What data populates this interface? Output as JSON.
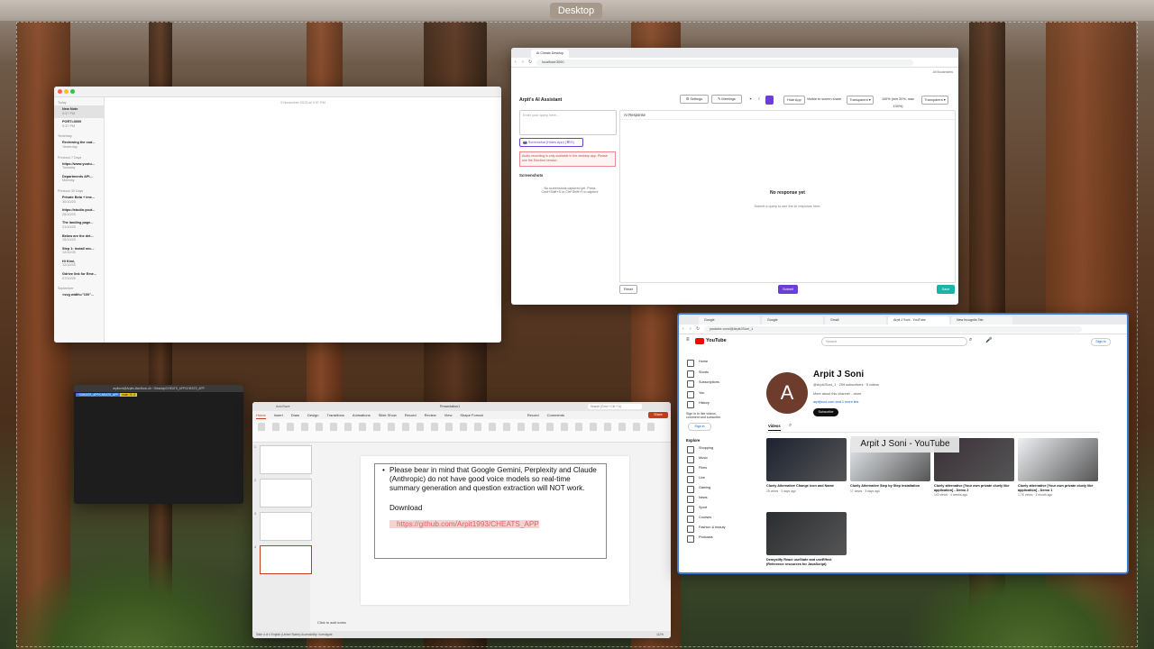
{
  "desktop": {
    "label": "Desktop"
  },
  "notes": {
    "timestamp": "9 November 2025 at 9:37 PM",
    "sections": [
      {
        "name": "Today",
        "items": [
          {
            "title": "New Note",
            "sub": "9:37 PM",
            "selected": true
          },
          {
            "title": "PORT=3000",
            "sub": "9:37 PM"
          }
        ]
      },
      {
        "name": "Yesterday",
        "items": [
          {
            "title": "Reviewing the cod...",
            "sub": "Yesterday"
          }
        ]
      },
      {
        "name": "Previous 7 Days",
        "items": [
          {
            "title": "https://www.youtu...",
            "sub": "Tuesday"
          },
          {
            "title": "Departments API...",
            "sub": "Monday"
          }
        ]
      },
      {
        "name": "Previous 30 Days",
        "items": [
          {
            "title": "Private Beta + Ime...",
            "sub": "30/10/25"
          },
          {
            "title": "https://studio.yout...",
            "sub": "26/10/25"
          },
          {
            "title": "The landing page...",
            "sub": "21/10/25"
          },
          {
            "title": "Below are the det...",
            "sub": "15/10/25"
          },
          {
            "title": "Step 1: Install nec...",
            "sub": "12/10/25"
          },
          {
            "title": "Hi Kimi,",
            "sub": "12/10/25"
          },
          {
            "title": "Gdrive link for Eme...",
            "sub": "07/10/25"
          }
        ]
      },
      {
        "name": "September",
        "items": [
          {
            "title": "<svg width=\"100\"...",
            "sub": ""
          }
        ]
      }
    ]
  },
  "ai": {
    "tab": "AI Cheats Desktop",
    "url": "localhost:3000",
    "bookmarks": "All Bookmarks",
    "title": "Arpit's AI Assistant",
    "buttons": {
      "settings": "⚙ Settings",
      "meetings": "✎ Meetings",
      "hide": "Hide App",
      "visible": "Visible to screen share",
      "transparent": "Transparent ▾",
      "opacity": "100% (min 20%, max 100%)",
      "transparent2": "Transparent ▾"
    },
    "query_placeholder": "Enter your query here...",
    "screenshot_btn": "📷 Screenshot (Hides App) (⌘/S)",
    "warning": "Audio recording is only available in the desktop app. Please use the Electron version.",
    "screenshots_head": "Screenshots",
    "no_screenshots": "No screenshots captured yet. Press Cmd+Shift+S or Ctrl+Shift+S to capture",
    "response_head": "AI Response",
    "no_response": "No response yet",
    "no_response_sub": "Submit a query to see the AI response here.",
    "reset": "Reset",
    "submit": "Submit",
    "save": "Save"
  },
  "terminal": {
    "title": "arpitsoni@Arpits-MacBook-Air ~/Desktop/CHEATS_APP/CHEATS_APP",
    "seg1": "~/CHEATS_APP/CHEATS_APP",
    "seg2": "main ?1 !2"
  },
  "ppt": {
    "autosave": "AutoSave",
    "name": "Presentation1",
    "search": "Search (Cmd + Ctrl + U)",
    "menu": [
      "Home",
      "Insert",
      "Draw",
      "Design",
      "Transitions",
      "Animations",
      "Slide Show",
      "Record",
      "Review",
      "View",
      "Shape Format"
    ],
    "record": "Record",
    "comments": "Comments",
    "share": "Share",
    "bullet": "Please bear in mind that Google Gemini, Perplexity and Claude (Anthropic) do not have good voice models so real-time summary generation and question extraction will NOT work.",
    "download": "Download",
    "link": "https://github.com/Arpit1993/CHEATS_APP",
    "notes": "Click to add notes",
    "status": "Slide 4 of 4   English (United States)   Accessibility: Investigate",
    "zoom": "112%",
    "slide_numbers": [
      "1",
      "2",
      "3",
      "4"
    ]
  },
  "youtube": {
    "tabs": [
      "Google",
      "Google",
      "Gmail",
      "Arpit J Soni - YouTube",
      "New Incognito Tab"
    ],
    "url": "youtube.com/@ArpitJSoni_1",
    "logo": "YouTube",
    "search_placeholder": "Search",
    "signin": "Sign in",
    "sidebar": [
      "Home",
      "Shorts",
      "Subscriptions",
      "You",
      "History"
    ],
    "signin_prompt": "Sign in to like videos, comment and subscribe.",
    "explore": "Explore",
    "explore_items": [
      "Shopping",
      "Music",
      "Films",
      "Live",
      "Gaming",
      "News",
      "Sport",
      "Courses",
      "Fashion & beauty",
      "Podcasts"
    ],
    "channel_name": "Arpit J Soni",
    "channel_meta": "@ArpitJSoni_1 · 299 subscribers · 5 videos",
    "channel_more": "More about this channel ...more",
    "channel_link": "arpitjsoni.com and 1 more link",
    "subscribe": "Subscribe",
    "videos_tab": "Videos",
    "tooltip": "Arpit J Soni - YouTube",
    "videos": [
      {
        "title": "Cluely Alternative Change Icon and Name",
        "meta": "15 views · 3 days ago"
      },
      {
        "title": "Cluely Alternative Step by Step Installation",
        "meta": "17 views · 3 days ago"
      },
      {
        "title": "Cluely alternative [Your own private cluely like application] - Demo 2",
        "meta": "103 views · 4 weeks ago"
      },
      {
        "title": "Cluely alternative [Your own private cluely like application] - Demo 1",
        "meta": "1.7K views · 1 month ago"
      },
      {
        "title": "Demystify React useState and useEffect (Reference resources for JavaScript)",
        "meta": ""
      }
    ]
  }
}
